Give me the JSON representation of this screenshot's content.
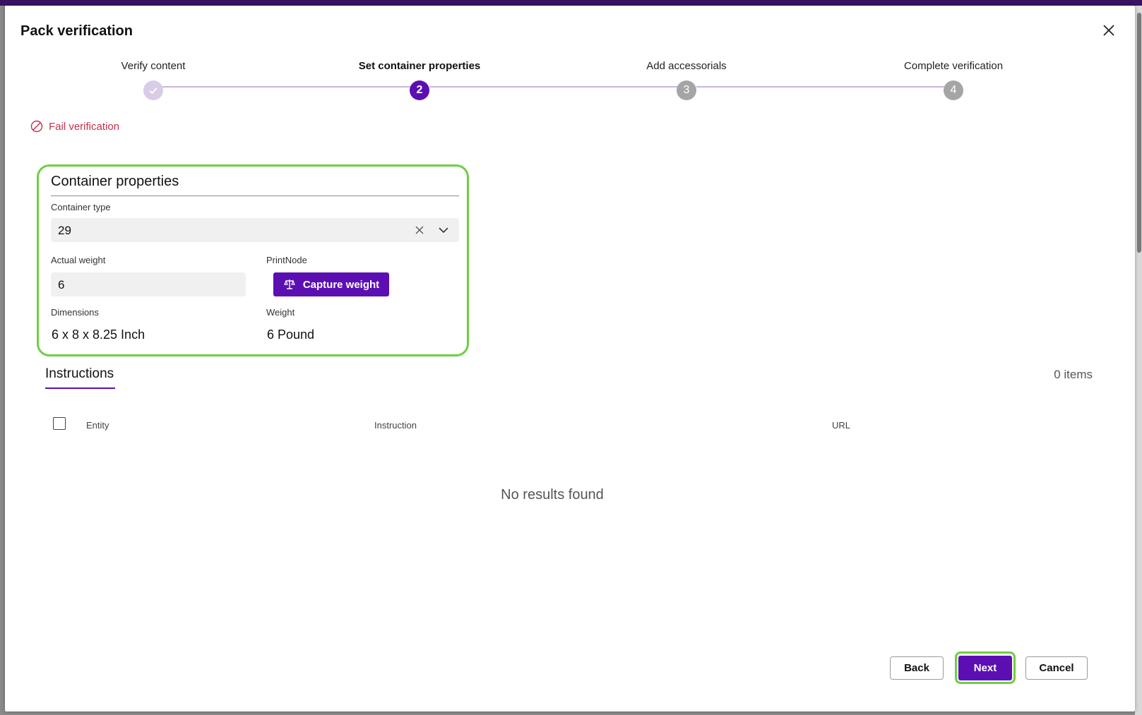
{
  "dialog": {
    "title": "Pack verification"
  },
  "steps": [
    {
      "label": "Verify content",
      "number": "",
      "state": "done"
    },
    {
      "label": "Set container properties",
      "number": "2",
      "state": "current"
    },
    {
      "label": "Add accessorials",
      "number": "3",
      "state": "pending"
    },
    {
      "label": "Complete verification",
      "number": "4",
      "state": "pending"
    }
  ],
  "fail_verification": "Fail verification",
  "container": {
    "title": "Container properties",
    "type_label": "Container type",
    "type_value": "29",
    "actual_weight_label": "Actual weight",
    "actual_weight_value": "6",
    "printnode_label": "PrintNode",
    "capture_button": "Capture weight",
    "dimensions_label": "Dimensions",
    "dimensions_value": "6 x 8 x 8.25 Inch",
    "weight_label": "Weight",
    "weight_value": "6 Pound"
  },
  "instructions": {
    "title": "Instructions",
    "count": "0 items",
    "columns": [
      "Entity",
      "Instruction",
      "URL"
    ],
    "empty_text": "No results found"
  },
  "footer": {
    "back": "Back",
    "next": "Next",
    "cancel": "Cancel"
  },
  "colors": {
    "accent": "#5b0fb3",
    "highlight": "#6fce43",
    "danger": "#c4314b"
  }
}
